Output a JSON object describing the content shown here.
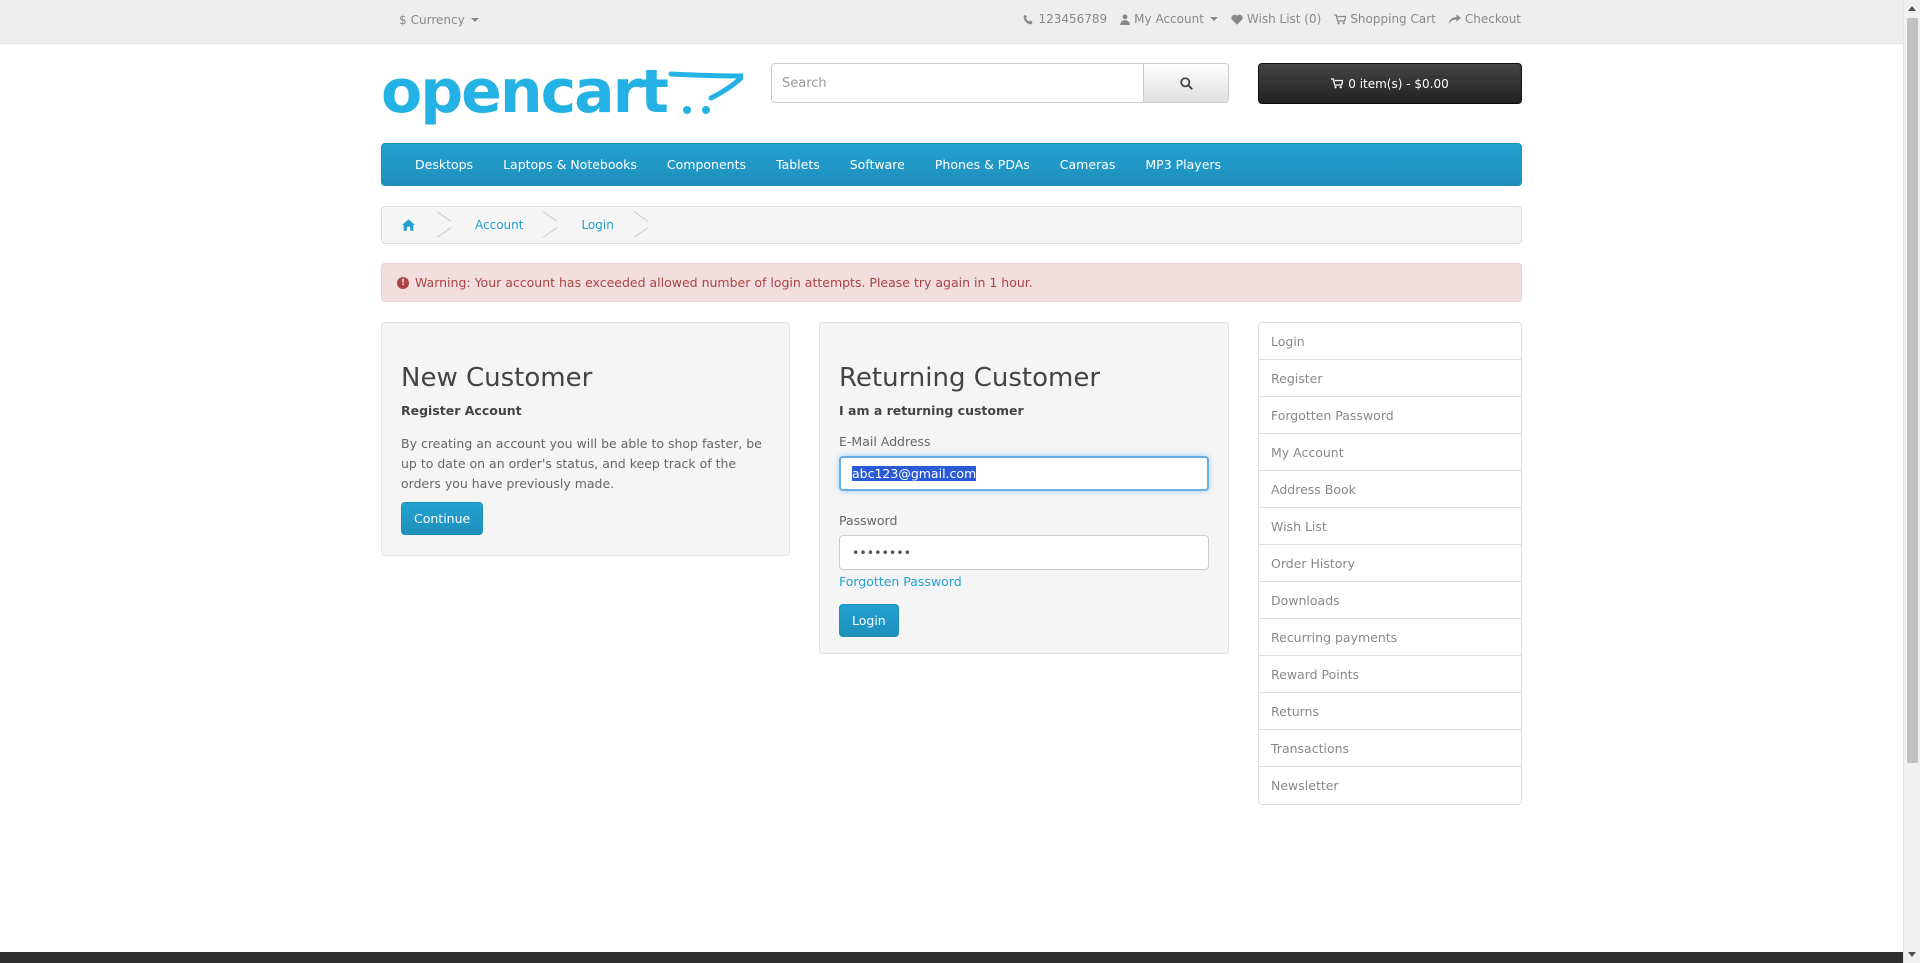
{
  "topbar": {
    "currency_symbol": "$",
    "currency_label": "Currency",
    "phone": "123456789",
    "my_account": "My Account",
    "wish_list": "Wish List (0)",
    "shopping_cart": "Shopping Cart",
    "checkout": "Checkout"
  },
  "header": {
    "logo_text": "opencart",
    "search_placeholder": "Search",
    "cart_label": "0 item(s) - $0.00"
  },
  "menu": {
    "items": [
      "Desktops",
      "Laptops & Notebooks",
      "Components",
      "Tablets",
      "Software",
      "Phones & PDAs",
      "Cameras",
      "MP3 Players"
    ]
  },
  "breadcrumb": {
    "items": [
      "Account",
      "Login"
    ]
  },
  "alert": {
    "text": "Warning: Your account has exceeded allowed number of login attempts. Please try again in 1 hour."
  },
  "new_customer": {
    "title": "New Customer",
    "subtitle": "Register Account",
    "description": "By creating an account you will be able to shop faster, be up to date on an order's status, and keep track of the orders you have previously made.",
    "button": "Continue"
  },
  "returning_customer": {
    "title": "Returning Customer",
    "subtitle": "I am a returning customer",
    "email_label": "E-Mail Address",
    "email_value": "abc123@gmail.com",
    "password_label": "Password",
    "password_value": "••••••••",
    "forgotten_link": "Forgotten Password",
    "button": "Login"
  },
  "sidebar": {
    "items": [
      "Login",
      "Register",
      "Forgotten Password",
      "My Account",
      "Address Book",
      "Wish List",
      "Order History",
      "Downloads",
      "Recurring payments",
      "Reward Points",
      "Returns",
      "Transactions",
      "Newsletter"
    ]
  },
  "colors": {
    "accent": "#23a1d1",
    "alert_bg": "#f2dede",
    "alert_text": "#a94442",
    "cart_bg": "#222222"
  }
}
